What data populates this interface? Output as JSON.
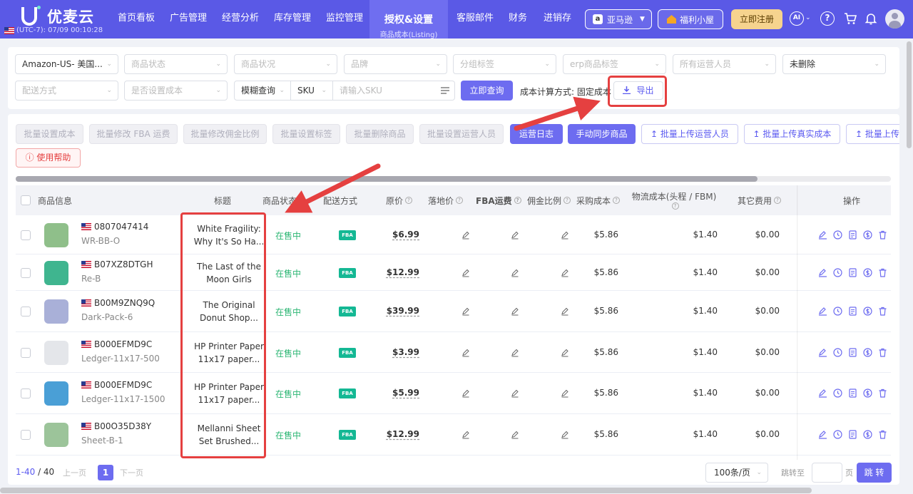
{
  "brand": {
    "name": "优麦云",
    "timezone": "(UTC-7): 07/09 00:10:28"
  },
  "nav": {
    "items": [
      "首页看板",
      "广告管理",
      "经营分析",
      "库存管理",
      "监控管理",
      "客服邮件",
      "财务",
      "进销存"
    ],
    "active_label": "授权&设置",
    "active_sub": "商品成本(Listing)"
  },
  "header": {
    "marketplace": "亚马逊",
    "welfare": "福利小屋",
    "register": "立即注册",
    "ai": "AI"
  },
  "filters": {
    "site": "Amazon-US- 美国...",
    "status_ph": "商品状态",
    "condition_ph": "商品状况",
    "brand_ph": "品牌",
    "group_ph": "分组标签",
    "erp_tag_ph": "erp商品标签",
    "operator_ph": "所有运营人员",
    "deleted": "未删除",
    "shipping_ph": "配送方式",
    "cost_set_ph": "是否设置成本",
    "query_mode": "模糊查询",
    "field": "SKU",
    "search_ph": "请输入SKU",
    "query_button": "立即查询",
    "cost_mode": "成本计算方式: 固定成本",
    "export_button": "导出"
  },
  "actions": [
    {
      "label": "批量设置成本",
      "style": "dis"
    },
    {
      "label": "批量修改 FBA 运费",
      "style": "dis"
    },
    {
      "label": "批量修改佣金比例",
      "style": "dis"
    },
    {
      "label": "批量设置标签",
      "style": "dis"
    },
    {
      "label": "批量删除商品",
      "style": "dis"
    },
    {
      "label": "批量设置运营人员",
      "style": "dis"
    },
    {
      "label": "运营日志",
      "style": "pri"
    },
    {
      "label": "手动同步商品",
      "style": "pri"
    },
    {
      "label": "批量上传运营人员",
      "style": "out"
    },
    {
      "label": "批量上传真实成本",
      "style": "out"
    },
    {
      "label": "批量上传成",
      "style": "out"
    }
  ],
  "help_button": "使用帮助",
  "table": {
    "headers": {
      "product": "商品信息",
      "title": "标题",
      "status": "商品状态",
      "shipping": "配送方式",
      "price": "原价",
      "landed": "落地价",
      "fba": "FBA运费",
      "commission": "佣金比例",
      "purchase": "采购成本",
      "logistics": "物流成本(头程 / FBM)",
      "other": "其它费用",
      "ops": "操作"
    },
    "rows": [
      {
        "asin": "0807047414",
        "sku": "WR-BB-O",
        "title1": "White Fragility:",
        "title2": "Why It's So Ha...",
        "status": "在售中",
        "ship": "FBA",
        "price": "$6.99",
        "purchase": "$5.86",
        "logistics": "$1.40",
        "other": "$0.00",
        "thumb_color": "#8fbf8a"
      },
      {
        "asin": "B07XZ8DTGH",
        "sku": "Re-B",
        "title1": "The Last of the",
        "title2": "Moon Girls",
        "status": "在售中",
        "ship": "FBA",
        "price": "$12.99",
        "purchase": "$5.86",
        "logistics": "$1.40",
        "other": "$0.00",
        "thumb_color": "#3fb58f"
      },
      {
        "asin": "B00M9ZNQ9Q",
        "sku": "Dark-Pack-6",
        "title1": "The Original",
        "title2": "Donut Shop...",
        "status": "在售中",
        "ship": "FBA",
        "price": "$39.99",
        "purchase": "$5.86",
        "logistics": "$1.40",
        "other": "$0.00",
        "thumb_color": "#a9b0d8"
      },
      {
        "asin": "B000EFMD9C",
        "sku": "Ledger-11x17-500",
        "title1": "HP Printer Paper",
        "title2": "11x17 paper...",
        "status": "在售中",
        "ship": "FBA",
        "price": "$3.99",
        "purchase": "$5.86",
        "logistics": "$1.40",
        "other": "$0.00",
        "thumb_color": "#e4e6ea"
      },
      {
        "asin": "B000EFMD9C",
        "sku": "Ledger-11x17-1500",
        "title1": "HP Printer Paper",
        "title2": "11x17 paper...",
        "status": "在售中",
        "ship": "FBA",
        "price": "$5.99",
        "purchase": "$5.86",
        "logistics": "$1.40",
        "other": "$0.00",
        "thumb_color": "#4a9fd6"
      },
      {
        "asin": "B00O35D38Y",
        "sku": "Sheet-B-1",
        "title1": "Mellanni Sheet",
        "title2": "Set Brushed...",
        "status": "在售中",
        "ship": "FBA",
        "price": "$12.99",
        "purchase": "$5.86",
        "logistics": "$1.40",
        "other": "$0.00",
        "thumb_color": "#9cc49a"
      }
    ]
  },
  "pager": {
    "range": "1-40",
    "total": "/ 40",
    "prev": "上一页",
    "page": "1",
    "next": "下一页",
    "size": "100条/页",
    "jump": "跳转至",
    "unit": "页",
    "go": "跳 转"
  },
  "colors": {
    "primary": "#5a59e6",
    "accent": "#6d6cf0",
    "highlight": "#e54040",
    "success": "#2bb673"
  }
}
